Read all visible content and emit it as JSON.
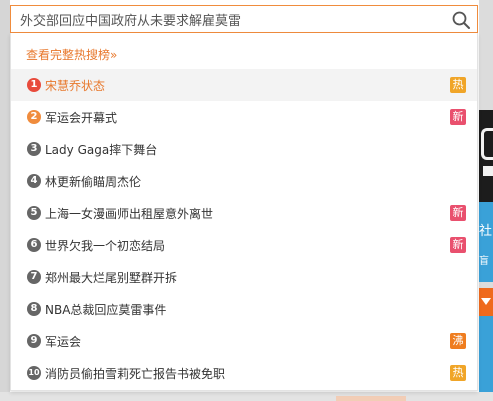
{
  "search": {
    "value": "外交部回应中国政府从未要求解雇莫雷",
    "button_icon": "search-icon"
  },
  "dropdown": {
    "full_list_link": "查看完整热搜榜»",
    "items": [
      {
        "rank": "1",
        "title": "宋慧乔状态",
        "tag": "热",
        "rank_color": "#e84b3c",
        "tag_color": "#f0a528",
        "active": true
      },
      {
        "rank": "2",
        "title": "军运会开幕式",
        "tag": "新",
        "rank_color": "#f08c3d",
        "tag_color": "#e9506e",
        "active": false
      },
      {
        "rank": "3",
        "title": "Lady Gaga摔下舞台",
        "tag": "",
        "rank_color": "#666666",
        "tag_color": "",
        "active": false
      },
      {
        "rank": "4",
        "title": "林更新偷瞄周杰伦",
        "tag": "",
        "rank_color": "#666666",
        "tag_color": "",
        "active": false
      },
      {
        "rank": "5",
        "title": "上海一女漫画师出租屋意外离世",
        "tag": "新",
        "rank_color": "#666666",
        "tag_color": "#e9506e",
        "active": false
      },
      {
        "rank": "6",
        "title": "世界欠我一个初恋结局",
        "tag": "新",
        "rank_color": "#666666",
        "tag_color": "#e9506e",
        "active": false
      },
      {
        "rank": "7",
        "title": "郑州最大烂尾别墅群开拆",
        "tag": "",
        "rank_color": "#666666",
        "tag_color": "",
        "active": false
      },
      {
        "rank": "8",
        "title": "NBA总裁回应莫雷事件",
        "tag": "",
        "rank_color": "#666666",
        "tag_color": "",
        "active": false
      },
      {
        "rank": "9",
        "title": "军运会",
        "tag": "沸",
        "rank_color": "#666666",
        "tag_color": "#ef7d1f",
        "active": false
      },
      {
        "rank": "10",
        "title": "消防员偷拍雪莉死亡报告书被免职",
        "tag": "热",
        "rank_color": "#666666",
        "tag_color": "#f0a528",
        "active": false
      }
    ]
  },
  "background": {
    "right_text_1": "社",
    "right_text_2": "盲"
  },
  "colors": {
    "accent": "#f08c3d",
    "link": "#e8792e",
    "hot_tag": "#f0a528",
    "new_tag": "#e9506e",
    "boil_tag": "#ef7d1f"
  }
}
